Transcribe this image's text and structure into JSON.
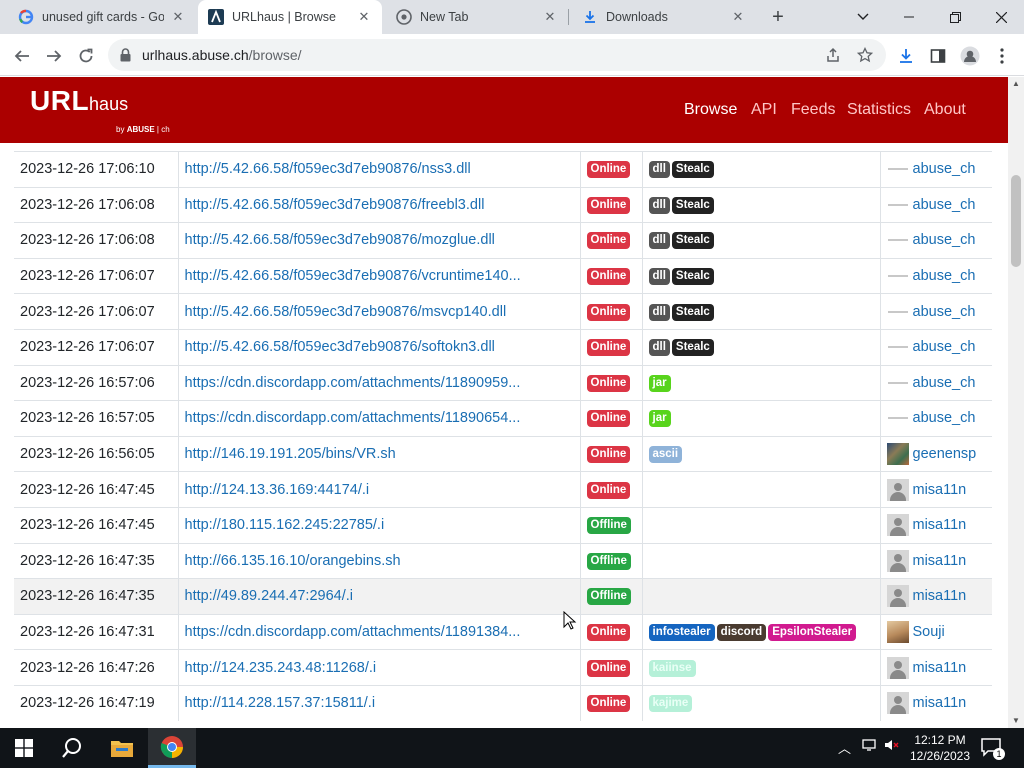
{
  "browser": {
    "tabs": [
      {
        "title": "unused gift cards - Go",
        "icon": "google-icon",
        "active": false
      },
      {
        "title": "URLhaus | Browse",
        "icon": "urlhaus-icon",
        "active": true
      },
      {
        "title": "New Tab",
        "icon": "chrome-icon",
        "active": false
      },
      {
        "title": "Downloads",
        "icon": "download-icon",
        "active": false
      }
    ],
    "new_tab_symbol": "+",
    "address_host": "urlhaus.abuse.ch",
    "address_path": "/browse/"
  },
  "site": {
    "logo_main": "URL",
    "logo_sub": "haus",
    "logo_by": "by",
    "logo_brand": "ABUSE",
    "logo_brand_suffix": "ch",
    "nav": [
      {
        "label": "Browse",
        "active": true
      },
      {
        "label": "API",
        "active": false
      },
      {
        "label": "Feeds",
        "active": false
      },
      {
        "label": "Statistics",
        "active": false
      },
      {
        "label": "About",
        "active": false
      }
    ]
  },
  "rows": [
    {
      "date": "2023-12-26 17:06:10",
      "url": "http://5.42.66.58/f059ec3d7eb90876/nss3.dll",
      "status": "Online",
      "tags": [
        "dll",
        "Stealc"
      ],
      "reporter": "abuse_ch",
      "avatar": "abuse"
    },
    {
      "date": "2023-12-26 17:06:08",
      "url": "http://5.42.66.58/f059ec3d7eb90876/freebl3.dll",
      "status": "Online",
      "tags": [
        "dll",
        "Stealc"
      ],
      "reporter": "abuse_ch",
      "avatar": "abuse"
    },
    {
      "date": "2023-12-26 17:06:08",
      "url": "http://5.42.66.58/f059ec3d7eb90876/mozglue.dll",
      "status": "Online",
      "tags": [
        "dll",
        "Stealc"
      ],
      "reporter": "abuse_ch",
      "avatar": "abuse"
    },
    {
      "date": "2023-12-26 17:06:07",
      "url": "http://5.42.66.58/f059ec3d7eb90876/vcruntime140...",
      "status": "Online",
      "tags": [
        "dll",
        "Stealc"
      ],
      "reporter": "abuse_ch",
      "avatar": "abuse"
    },
    {
      "date": "2023-12-26 17:06:07",
      "url": "http://5.42.66.58/f059ec3d7eb90876/msvcp140.dll",
      "status": "Online",
      "tags": [
        "dll",
        "Stealc"
      ],
      "reporter": "abuse_ch",
      "avatar": "abuse"
    },
    {
      "date": "2023-12-26 17:06:07",
      "url": "http://5.42.66.58/f059ec3d7eb90876/softokn3.dll",
      "status": "Online",
      "tags": [
        "dll",
        "Stealc"
      ],
      "reporter": "abuse_ch",
      "avatar": "abuse"
    },
    {
      "date": "2023-12-26 16:57:06",
      "url": "https://cdn.discordapp.com/attachments/11890959...",
      "status": "Online",
      "tags": [
        "jar"
      ],
      "reporter": "abuse_ch",
      "avatar": "abuse"
    },
    {
      "date": "2023-12-26 16:57:05",
      "url": "https://cdn.discordapp.com/attachments/11890654...",
      "status": "Online",
      "tags": [
        "jar"
      ],
      "reporter": "abuse_ch",
      "avatar": "abuse"
    },
    {
      "date": "2023-12-26 16:56:05",
      "url": "http://146.19.191.205/bins/VR.sh",
      "status": "Online",
      "tags": [
        "ascii"
      ],
      "reporter": "geenensp",
      "avatar": "geenensp"
    },
    {
      "date": "2023-12-26 16:47:45",
      "url": "http://124.13.36.169:44174/.i",
      "status": "Online",
      "tags": [],
      "reporter": "misa11n",
      "avatar": "misa"
    },
    {
      "date": "2023-12-26 16:47:45",
      "url": "http://180.115.162.245:22785/.i",
      "status": "Offline",
      "tags": [],
      "reporter": "misa11n",
      "avatar": "misa"
    },
    {
      "date": "2023-12-26 16:47:35",
      "url": "http://66.135.16.10/orangebins.sh",
      "status": "Offline",
      "tags": [],
      "reporter": "misa11n",
      "avatar": "misa"
    },
    {
      "date": "2023-12-26 16:47:35",
      "url": "http://49.89.244.47:2964/.i",
      "status": "Offline",
      "tags": [],
      "reporter": "misa11n",
      "avatar": "misa",
      "hover": true
    },
    {
      "date": "2023-12-26 16:47:31",
      "url": "https://cdn.discordapp.com/attachments/11891384...",
      "status": "Online",
      "tags": [
        "infostealer",
        "discord",
        "EpsilonStealer"
      ],
      "reporter": "Souji",
      "avatar": "souji"
    },
    {
      "date": "2023-12-26 16:47:26",
      "url": "http://124.235.243.48:11268/.i",
      "status": "Online",
      "tags": [
        "kaiinse"
      ],
      "reporter": "misa11n",
      "avatar": "misa"
    },
    {
      "date": "2023-12-26 16:47:19",
      "url": "http://114.228.157.37:15811/.i",
      "status": "Online",
      "tags": [
        "kajime"
      ],
      "reporter": "misa11n",
      "avatar": "misa"
    }
  ],
  "taskbar": {
    "time": "12:12 PM",
    "date": "12/26/2023",
    "notification_count": "1"
  },
  "colors": {
    "header": "#ab0000",
    "link": "#1a6eb3",
    "online": "#dc3545",
    "offline": "#28a745"
  }
}
